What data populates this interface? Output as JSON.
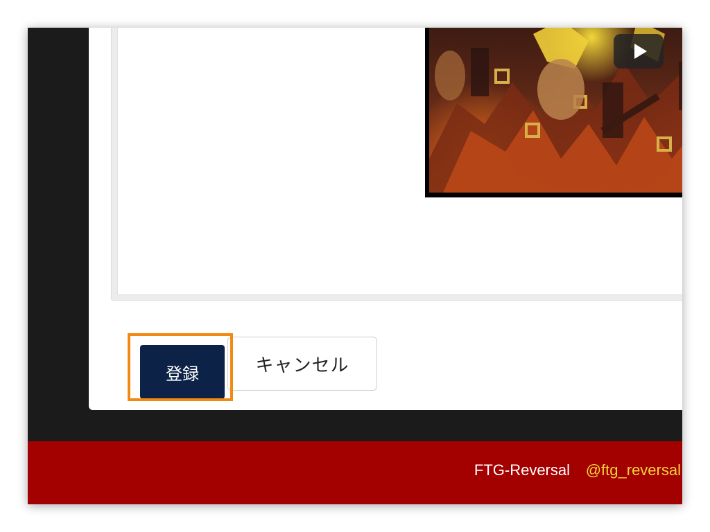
{
  "form": {
    "submit_label": "登録",
    "cancel_label": "キャンセル"
  },
  "footer": {
    "brand": "FTG-Reversal",
    "handle": "@ftg_reversal"
  },
  "colors": {
    "footer_bg": "#a30000",
    "submit_bg": "#0c2247",
    "highlight": "#f28a12",
    "handle_text": "#f4d43a",
    "page_bg": "#1b1b1b"
  },
  "icons": {
    "video_play": "play-icon"
  }
}
